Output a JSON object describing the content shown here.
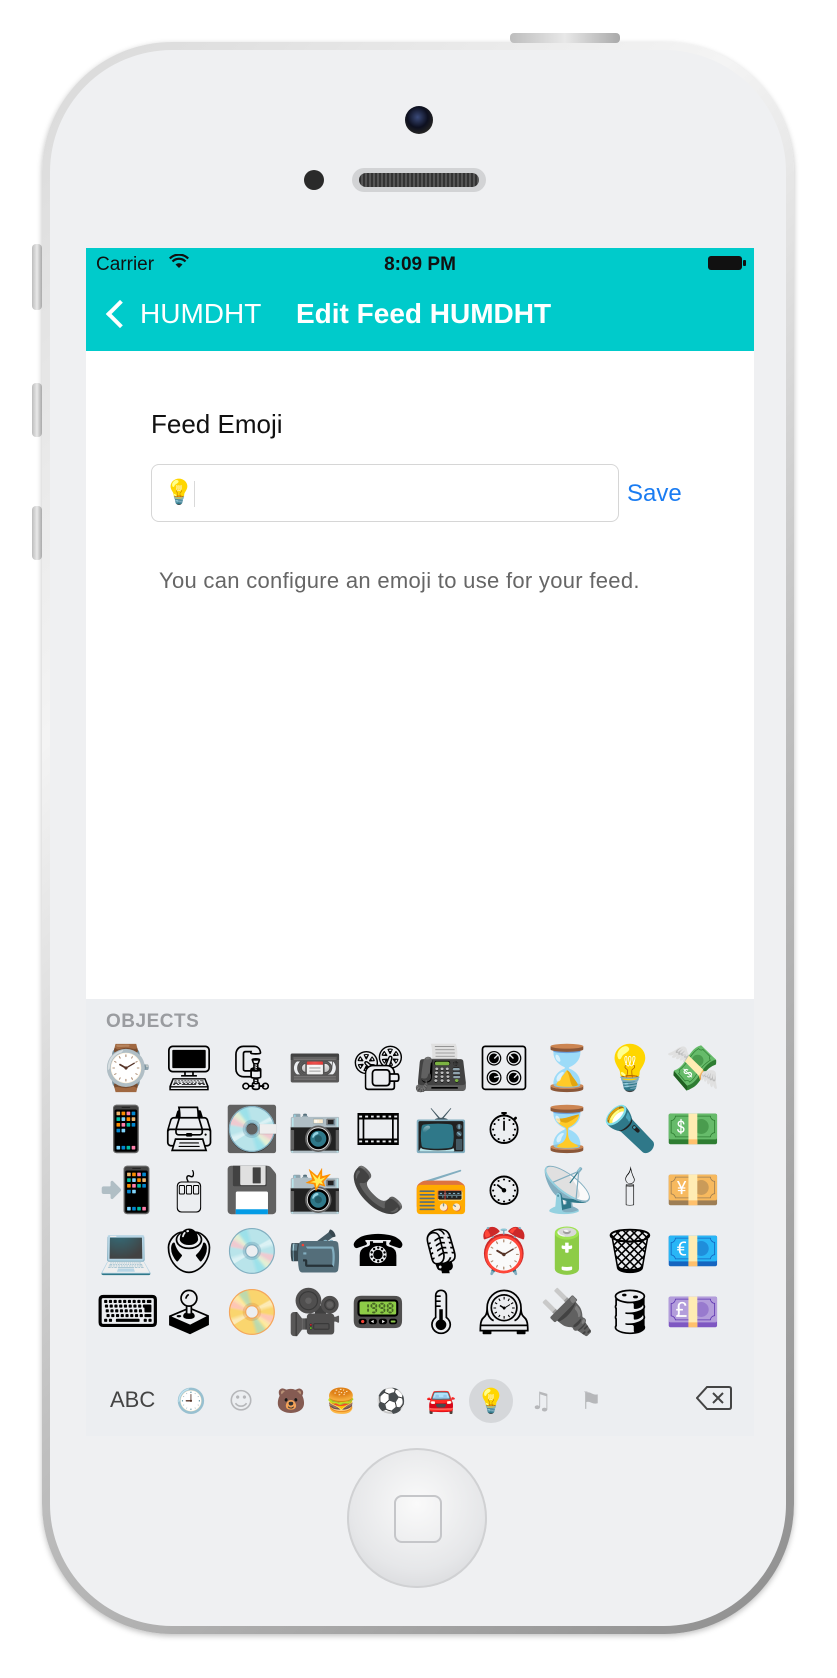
{
  "status": {
    "carrier": "Carrier",
    "time": "8:09 PM"
  },
  "nav": {
    "back_label": "HUMDHT",
    "title": "Edit Feed HUMDHT"
  },
  "form": {
    "label": "Feed Emoji",
    "emoji_value": "💡",
    "save_label": "Save",
    "hint": "You can configure an emoji to use for your feed."
  },
  "keyboard": {
    "section_title": "OBJECTS",
    "abc_label": "ABC",
    "emoji_rows": [
      [
        "⌚",
        "🖥",
        "🗜",
        "📼",
        "📽",
        "📠",
        "🎛",
        "⌛",
        "💡",
        "💸"
      ],
      [
        "📱",
        "🖨",
        "💽",
        "📷",
        "🎞",
        "📺",
        "⏱",
        "⏳",
        "🔦",
        "💵"
      ],
      [
        "📲",
        "🖱",
        "💾",
        "📸",
        "📞",
        "📻",
        "⏲",
        "📡",
        "🕯",
        "💴"
      ],
      [
        "💻",
        "🖲",
        "💿",
        "📹",
        "☎",
        "🎙",
        "⏰",
        "🔋",
        "🗑",
        "💶"
      ],
      [
        "⌨",
        "🕹",
        "📀",
        "🎥",
        "📟",
        "🌡",
        "🕰",
        "🔌",
        "🛢",
        "💷"
      ]
    ],
    "categories": [
      {
        "name": "recent-icon",
        "glyph": "🕘"
      },
      {
        "name": "smileys-icon",
        "glyph": "☺"
      },
      {
        "name": "animals-icon",
        "glyph": "🐻"
      },
      {
        "name": "food-icon",
        "glyph": "🍔"
      },
      {
        "name": "activity-icon",
        "glyph": "⚽"
      },
      {
        "name": "travel-icon",
        "glyph": "🚘"
      },
      {
        "name": "objects-icon",
        "glyph": "💡"
      },
      {
        "name": "symbols-icon",
        "glyph": "♫"
      },
      {
        "name": "flags-icon",
        "glyph": "⚑"
      }
    ],
    "active_category": "objects-icon"
  }
}
